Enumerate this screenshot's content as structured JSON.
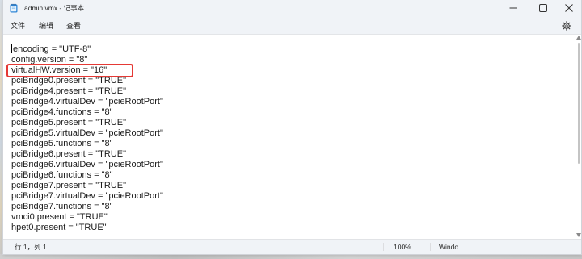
{
  "window": {
    "title": "admin.vmx - 记事本",
    "app_icon": "notepad-icon",
    "minimize_icon": "minimize-icon",
    "maximize_icon": "maximize-icon",
    "close_icon": "close-icon"
  },
  "menu": {
    "items": [
      "文件",
      "编辑",
      "查看"
    ],
    "settings_icon": "gear-icon"
  },
  "editor": {
    "lines": [
      "encoding = \"UTF-8\"",
      "config.version = \"8\"",
      "virtualHW.version = \"16\"",
      "pciBridge0.present = \"TRUE\"",
      "pciBridge4.present = \"TRUE\"",
      "pciBridge4.virtualDev = \"pcieRootPort\"",
      "pciBridge4.functions = \"8\"",
      "pciBridge5.present = \"TRUE\"",
      "pciBridge5.virtualDev = \"pcieRootPort\"",
      "pciBridge5.functions = \"8\"",
      "pciBridge6.present = \"TRUE\"",
      "pciBridge6.virtualDev = \"pcieRootPort\"",
      "pciBridge6.functions = \"8\"",
      "pciBridge7.present = \"TRUE\"",
      "pciBridge7.virtualDev = \"pcieRootPort\"",
      "pciBridge7.functions = \"8\"",
      "vmci0.present = \"TRUE\"",
      "hpet0.present = \"TRUE\""
    ]
  },
  "status_bar": {
    "position": "行 1，列 1",
    "zoom": "100%",
    "line_ending": "Windo"
  },
  "theme": {
    "chrome_background": "#f0f3f7",
    "editor_background": "#ffffff",
    "text_color": "#1a1a1a",
    "highlight_color": "#e53935"
  }
}
